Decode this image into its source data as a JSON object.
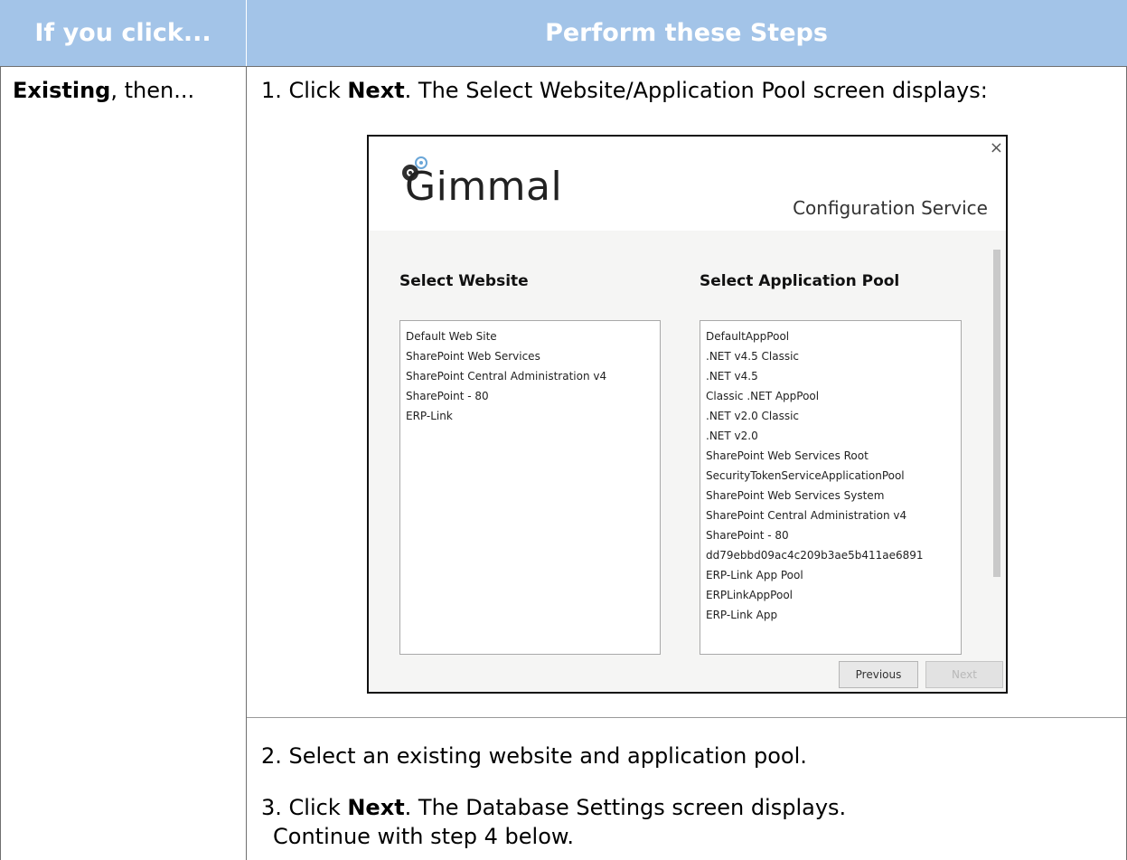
{
  "header": {
    "col1": "If you click...",
    "col2": "Perform these Steps"
  },
  "row": {
    "col1_bold": "Existing",
    "col1_rest": ", then...",
    "steps": [
      {
        "prefix": "1. Click ",
        "bold": "Next",
        "text": ". The Select Website/Application Pool screen displays:"
      },
      {
        "text": "2. Select an existing website and application pool."
      },
      {
        "prefix": "3. Click ",
        "bold": "Next",
        "text": ". The Database Settings screen displays.",
        "line2": "Continue with step 4 below."
      }
    ]
  },
  "dialog": {
    "close": "×",
    "logo": "Gimmal",
    "subtitle": "Configuration Service",
    "website_heading": "Select Website",
    "apppool_heading": "Select Application Pool",
    "websites": [
      "Default Web Site",
      "SharePoint Web Services",
      "SharePoint Central Administration v4",
      "SharePoint - 80",
      "ERP-Link"
    ],
    "app_pools": [
      "DefaultAppPool",
      ".NET v4.5 Classic",
      ".NET v4.5",
      "Classic .NET AppPool",
      ".NET v2.0 Classic",
      ".NET v2.0",
      "SharePoint Web Services Root",
      "SecurityTokenServiceApplicationPool",
      "SharePoint Web Services System",
      "SharePoint Central Administration v4",
      "SharePoint - 80",
      "dd79ebbd09ac4c209b3ae5b411ae6891",
      "ERP-Link App Pool",
      "ERPLinkAppPool",
      "ERP-Link App"
    ],
    "previous_label": "Previous",
    "next_label": "Next"
  }
}
